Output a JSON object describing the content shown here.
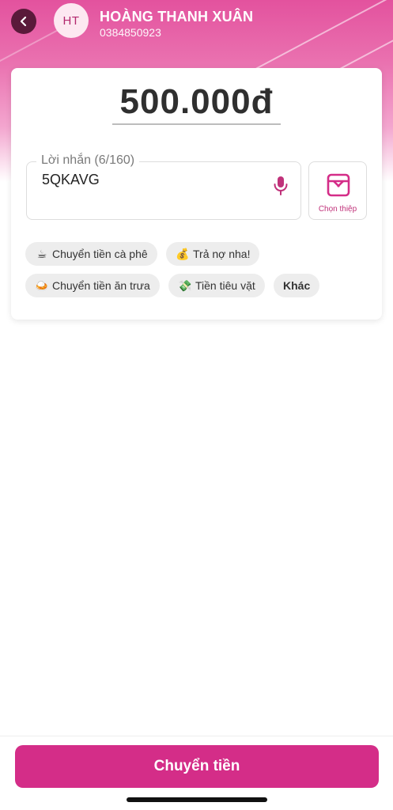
{
  "header": {
    "avatar_initials": "HT",
    "name": "HOÀNG THANH XUÂN",
    "phone": "0384850923"
  },
  "amount": {
    "value": "500.000đ"
  },
  "message": {
    "label": "Lời nhắn (6/160)",
    "value": "5QKAVG"
  },
  "card_picker": {
    "label": "Chọn thiệp"
  },
  "suggestions": [
    {
      "emoji": "☕",
      "label": "Chuyển tiền cà phê"
    },
    {
      "emoji": "💰",
      "label": "Trả nợ nha!"
    },
    {
      "emoji": "🍛",
      "label": "Chuyển tiền ăn trưa"
    },
    {
      "emoji": "💸",
      "label": "Tiền tiêu vặt"
    },
    {
      "emoji": "",
      "label": "Khác"
    }
  ],
  "footer": {
    "submit_label": "Chuyển tiền"
  },
  "colors": {
    "brand": "#d42d88",
    "header_gradient_top": "#e3529e",
    "back_button": "#5a1a3a"
  },
  "icons": {
    "back": "chevron-left-icon",
    "mic": "microphone-icon",
    "card": "greeting-card-icon"
  }
}
